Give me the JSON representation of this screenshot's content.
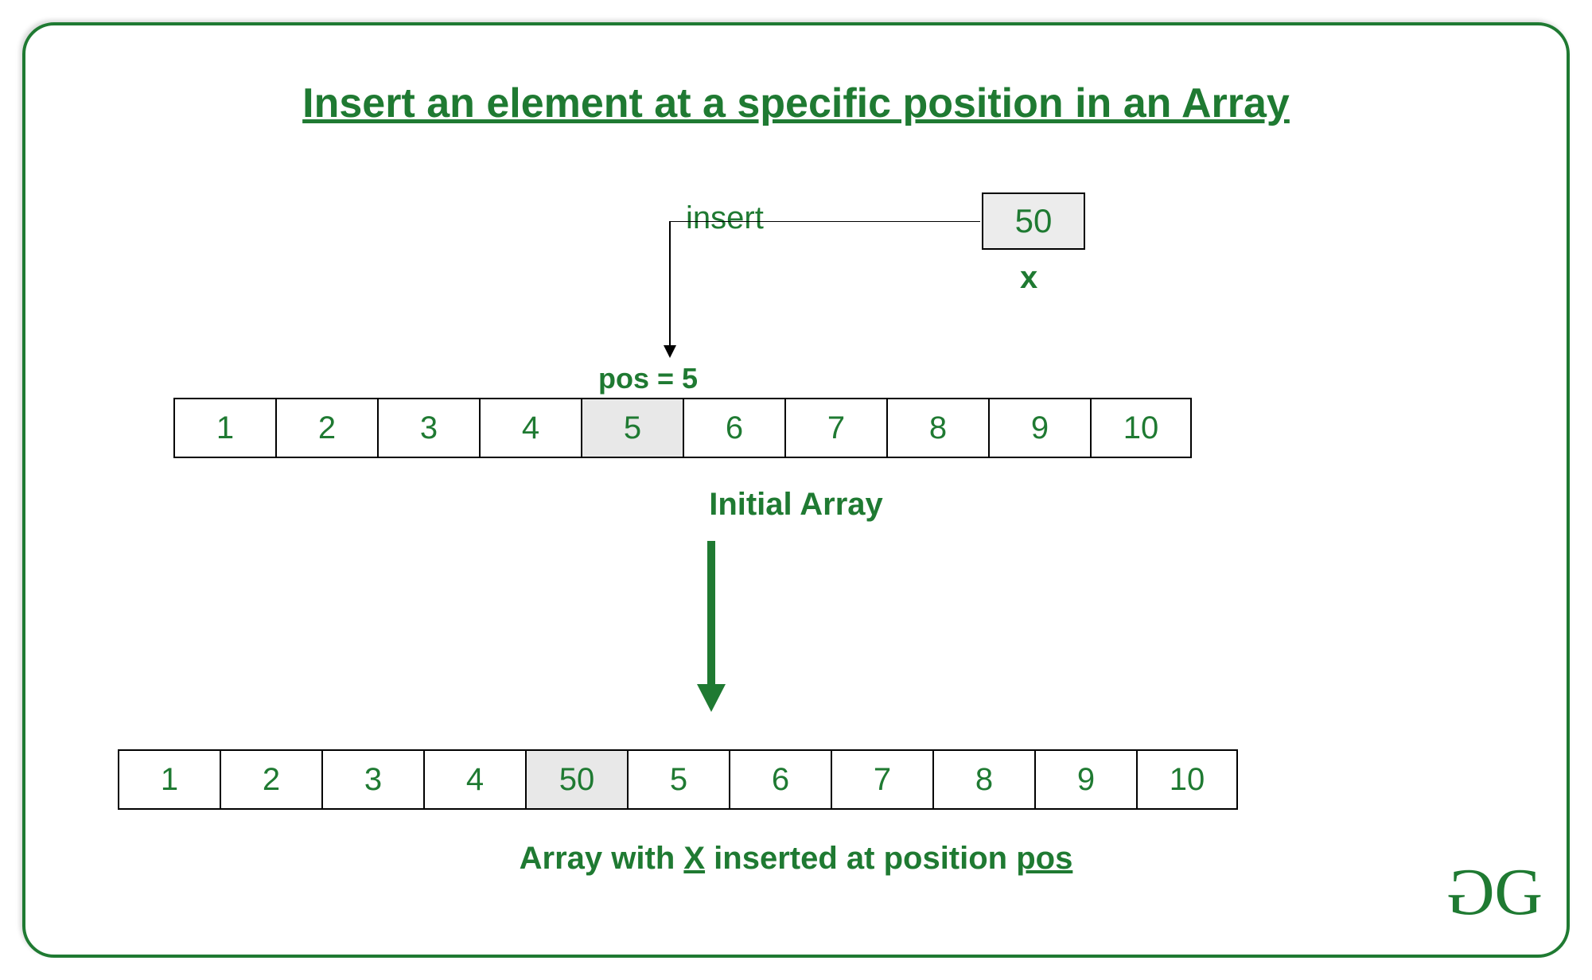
{
  "title": "Insert an element at a specific position in an Array",
  "insert": {
    "action_label": "insert",
    "x_value": "50",
    "x_label": "x",
    "pos_label": "pos = 5",
    "pos_index": 5
  },
  "initial_array": {
    "values": [
      "1",
      "2",
      "3",
      "4",
      "5",
      "6",
      "7",
      "8",
      "9",
      "10"
    ],
    "caption": "Initial Array",
    "highlight_index": 4
  },
  "result_array": {
    "values": [
      "1",
      "2",
      "3",
      "4",
      "50",
      "5",
      "6",
      "7",
      "8",
      "9",
      "10"
    ],
    "caption_parts": {
      "prefix": "Array with ",
      "var1": "X",
      "middle": " inserted at position ",
      "var2": "pos"
    },
    "highlight_index": 4
  },
  "colors": {
    "brand": "#1f7a32"
  },
  "logo_text": "GG"
}
